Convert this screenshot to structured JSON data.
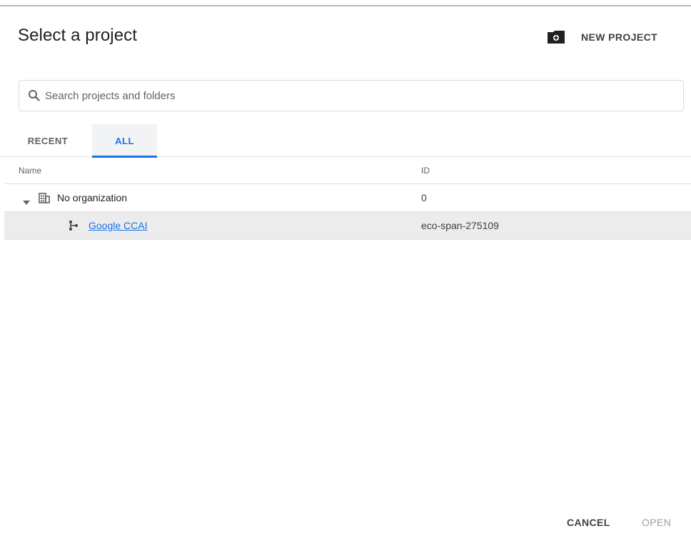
{
  "dialog": {
    "title": "Select a project",
    "new_project_label": "NEW PROJECT"
  },
  "search": {
    "placeholder": "Search projects and folders",
    "value": ""
  },
  "tabs": [
    {
      "label": "RECENT",
      "active": false
    },
    {
      "label": "ALL",
      "active": true
    }
  ],
  "table": {
    "columns": [
      "Name",
      "ID"
    ],
    "rows": [
      {
        "type": "organization",
        "name": "No organization",
        "id": "0",
        "expanded": true,
        "icon": "organization-icon"
      },
      {
        "type": "project",
        "name": "Google CCAI",
        "id": "eco-span-275109",
        "selected": true,
        "icon": "project-icon"
      }
    ]
  },
  "footer": {
    "cancel_label": "CANCEL",
    "open_label": "OPEN"
  },
  "colors": {
    "accent": "#1a73e8",
    "selected_row": "#ececec",
    "disabled_text": "#9aa0a6"
  }
}
